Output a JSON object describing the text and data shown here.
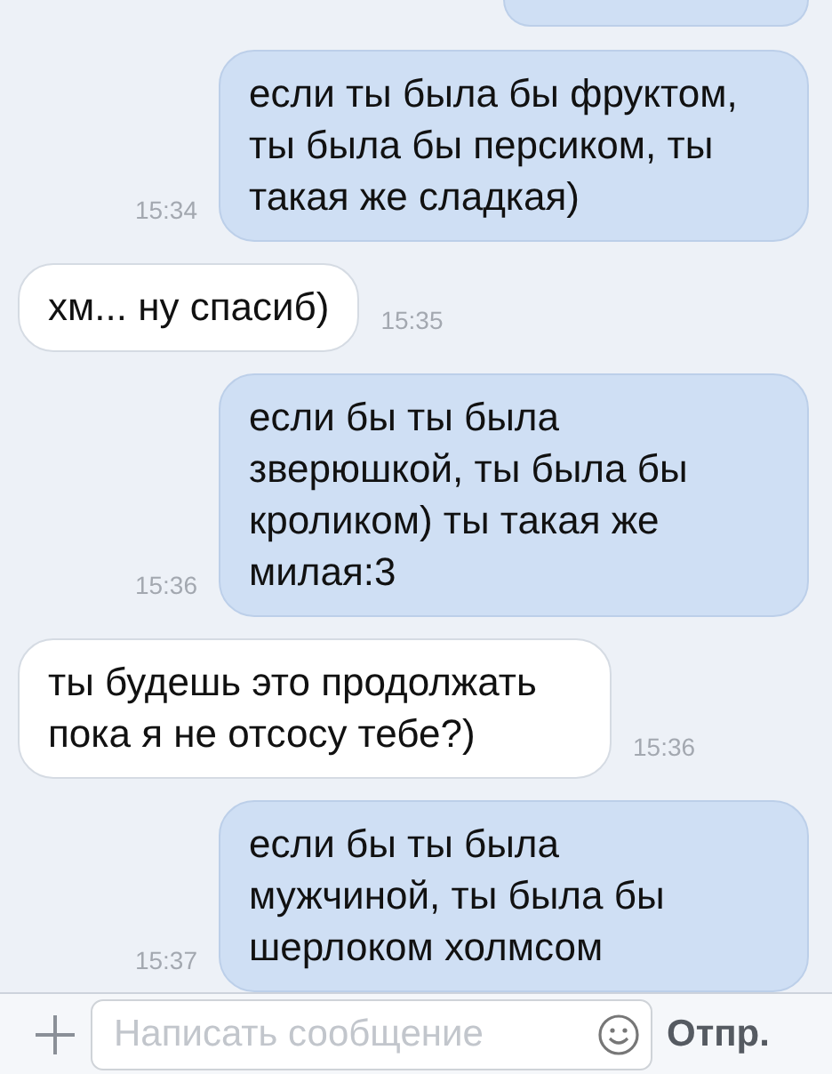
{
  "messages": [
    {
      "kind": "outgoing",
      "cut": true
    },
    {
      "kind": "outgoing",
      "text": "если ты была бы фруктом, ты была бы персиком, ты такая же сладкая)",
      "time": "15:34"
    },
    {
      "kind": "incoming",
      "text": "хм... ну спасиб)",
      "time": "15:35"
    },
    {
      "kind": "outgoing",
      "text": "если бы ты была зверюшкой, ты была бы кроликом) ты такая же милая:3",
      "time": "15:36"
    },
    {
      "kind": "incoming",
      "text": "ты будешь это продолжать пока я не отсосу тебе?)",
      "time": "15:36"
    },
    {
      "kind": "outgoing",
      "text": "если бы ты была мужчиной, ты была бы шерлоком холмсом",
      "time": "15:37"
    }
  ],
  "composer": {
    "placeholder": "Написать сообщение",
    "send": "Отпр."
  }
}
